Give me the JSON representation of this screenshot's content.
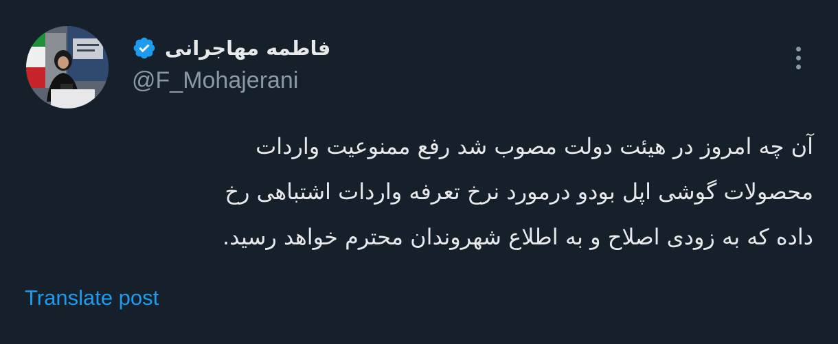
{
  "author": {
    "display_name": "فاطمه مهاجرانی",
    "handle": "@F_Mohajerani",
    "verified": true,
    "verified_badge_icon": "verified-check-icon",
    "avatar_icon": "profile-photo"
  },
  "post": {
    "lines": [
      "آن چه امروز در هیئت دولت مصوب شد رفع ممنوعیت واردات",
      "محصولات گوشی اپل بودو درمورد نرخ تعرفه واردات اشتباهی رخ",
      "داده که به زودی اصلاح و به اطلاع شهروندان محترم خواهد رسید."
    ]
  },
  "actions": {
    "translate_label": "Translate post",
    "more_icon": "more-vertical-icon"
  },
  "colors": {
    "background": "#15202b",
    "text_primary": "#e7e9ea",
    "text_secondary": "#8b98a5",
    "accent": "#1d9bf0"
  }
}
